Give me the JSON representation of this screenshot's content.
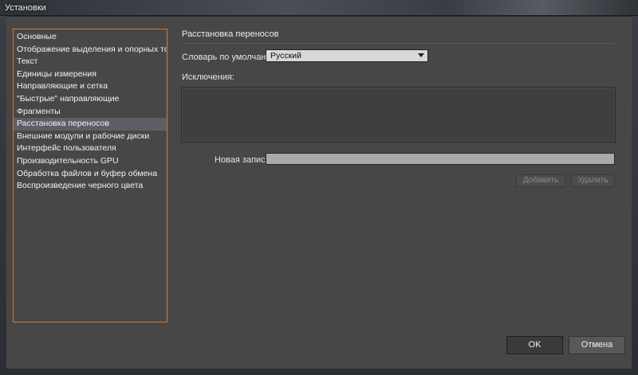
{
  "window": {
    "title": "Установки"
  },
  "categories": [
    {
      "label": "Основные"
    },
    {
      "label": "Отображение выделения и опорных точек"
    },
    {
      "label": "Текст"
    },
    {
      "label": "Единицы измерения"
    },
    {
      "label": "Направляющие и сетка"
    },
    {
      "label": "\"Быстрые\" направляющие"
    },
    {
      "label": "Фрагменты"
    },
    {
      "label": "Расстановка переносов"
    },
    {
      "label": "Внешние модули и рабочие диски"
    },
    {
      "label": "Интерфейс пользователя"
    },
    {
      "label": "Производительность GPU"
    },
    {
      "label": "Обработка файлов и буфер обмена"
    },
    {
      "label": "Воспроизведение черного цвета"
    }
  ],
  "selected_category_index": 7,
  "panel": {
    "title": "Расстановка переносов",
    "dictionary_label": "Словарь по умолчанию:",
    "dictionary_value": "Русский",
    "exceptions_label": "Исключения:",
    "new_entry_label": "Новая запись:",
    "new_entry_value": "",
    "add_label": "Добавить",
    "delete_label": "Удалить"
  },
  "footer": {
    "ok_label": "OK",
    "cancel_label": "Отмена"
  },
  "colors": {
    "accent_border": "#d9782f",
    "selected_row": "#5e5e68",
    "panel_bg": "#474747"
  }
}
